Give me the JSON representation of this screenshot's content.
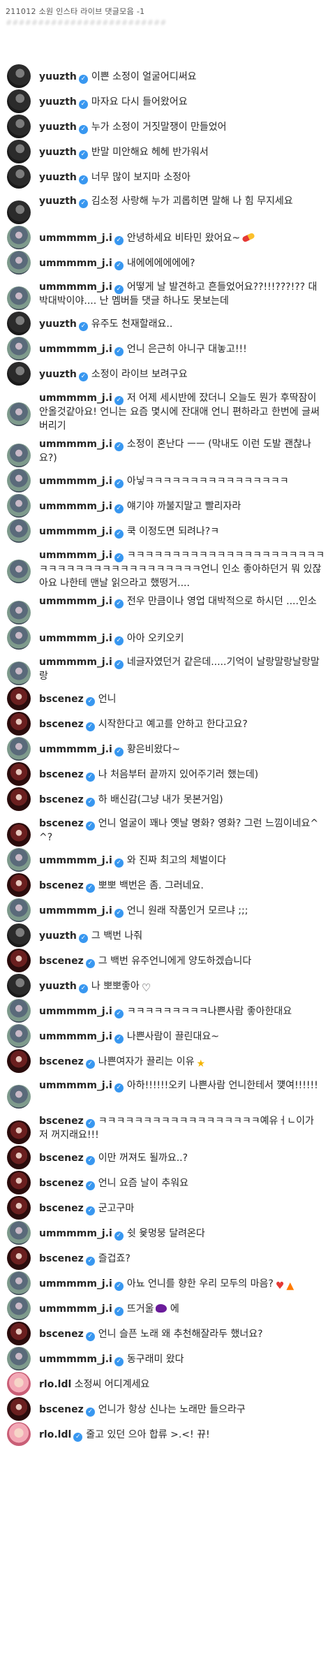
{
  "header": {
    "title": "211012 소원 인스타 라이브 댓글모음 -1",
    "subtitle": "#########################"
  },
  "users": {
    "yuuzth": "yuuzth",
    "ummmmm": "ummmmm_j.i",
    "bscenez": "bscenez",
    "rlo": "rlo.ldl"
  },
  "verified_icon": "verified-check-icon",
  "comments": [
    {
      "user": "yuuzth",
      "avatar": "yuuzth",
      "text": "이쁜 소정이 얼굴어디써요",
      "lines": 1
    },
    {
      "user": "yuuzth",
      "avatar": "yuuzth",
      "text": "마자요 다시 들어왔어요",
      "lines": 1
    },
    {
      "user": "yuuzth",
      "avatar": "yuuzth",
      "text": "누가 소정이 거짓말쟁이 만들었어",
      "lines": 1
    },
    {
      "user": "yuuzth",
      "avatar": "yuuzth",
      "text": "반말 미안해요 헤헤 반가워서",
      "lines": 1
    },
    {
      "user": "yuuzth",
      "avatar": "yuuzth",
      "text": "너무 많이 보지마 소정아",
      "lines": 1
    },
    {
      "user": "yuuzth",
      "avatar": "yuuzth",
      "text": "김소정 사랑해 누가 괴롭히면 말해 나 힘 무지세요",
      "lines": 2
    },
    {
      "user": "ummmmm",
      "avatar": "ummmmm",
      "text": "안녕하세요 비타민 왔어요~",
      "emoji": "pill",
      "lines": 1
    },
    {
      "user": "ummmmm",
      "avatar": "ummmmm",
      "text": "내에에에에에에?",
      "lines": 1
    },
    {
      "user": "ummmmm",
      "avatar": "ummmmm",
      "text": "어떻게 날 발견하고 흔들었어요??!!!???!?? 대박대박이야.... 난 멤버들 댓글 하나도 못보는데",
      "lines": 2
    },
    {
      "user": "yuuzth",
      "avatar": "yuuzth",
      "text": "유주도 천재할래요..",
      "lines": 1
    },
    {
      "user": "ummmmm",
      "avatar": "ummmmm",
      "text": "언니 은근히 아니구 대놓고!!!",
      "lines": 1
    },
    {
      "user": "yuuzth",
      "avatar": "yuuzth",
      "text": "소정이 라이브 보려구요",
      "lines": 1
    },
    {
      "user": "ummmmm",
      "avatar": "ummmmm",
      "text": "저 어제 세시반에 잤더니 오늘도 뭔가 후딱잠이 안올것같아요! 언니는 요즘 몇시에 잔대애 언니 편하라고 한번에 글써버리기",
      "lines": 3
    },
    {
      "user": "ummmmm",
      "avatar": "ummmmm",
      "text": "소정이 혼난다 ㅡㅡ (막내도 이런 도발 괜찮나요?)",
      "lines": 2
    },
    {
      "user": "ummmmm",
      "avatar": "ummmmm",
      "text": "아닣ㅋㅋㅋㅋㅋㅋㅋㅋㅋㅋㅋㅋㅋㅋㅋㅋ",
      "lines": 1
    },
    {
      "user": "ummmmm",
      "avatar": "ummmmm",
      "text": "얘기야 까불지말고 빨리자라",
      "lines": 1
    },
    {
      "user": "ummmmm",
      "avatar": "ummmmm",
      "text": "쿡 이정도면 되려나?ㅋ",
      "lines": 1
    },
    {
      "user": "ummmmm",
      "avatar": "ummmmm",
      "text": "ㅋㅋㅋㅋㅋㅋㅋㅋㅋㅋㅋㅋㅋㅋㅋㅋㅋㅋㅋㅋㅋㅋㅋㅋㅋㅋㅋㅋㅋㅋㅋㅋㅋㅋㅋㅋㅋㅋㅋㅋ언니 인소 좋아하던거 뭐 있잖아요 나한테 맨날 읽으라고 했떵거....",
      "lines": 3
    },
    {
      "user": "ummmmm",
      "avatar": "ummmmm",
      "text": "전우 만큼이나 영업 대박적으로 하시던 ....인소",
      "lines": 2
    },
    {
      "user": "ummmmm",
      "avatar": "ummmmm",
      "text": "아아 오키오키",
      "lines": 1
    },
    {
      "user": "ummmmm",
      "avatar": "ummmmm",
      "text": "네글자였던거 같은데.....기억이 날랑말랑날랑말랑",
      "lines": 2
    },
    {
      "user": "bscenez",
      "avatar": "bscenez",
      "text": "언니",
      "lines": 1
    },
    {
      "user": "bscenez",
      "avatar": "bscenez",
      "text": "시작한다고 예고를 안하고 한다고요?",
      "lines": 1
    },
    {
      "user": "ummmmm",
      "avatar": "ummmmm",
      "text": "황은비왔다~",
      "lines": 1
    },
    {
      "user": "bscenez",
      "avatar": "bscenez",
      "text": "나 처음부터 끝까지 있어주기러 했는데)",
      "lines": 1
    },
    {
      "user": "bscenez",
      "avatar": "bscenez",
      "text": "하 배신감(그냥 내가 못본거임)",
      "lines": 1
    },
    {
      "user": "bscenez",
      "avatar": "bscenez",
      "text": "언니 얼굴이 꽤나 옛날 명화? 영화? 그런 느낌이네요^^?",
      "lines": 2
    },
    {
      "user": "ummmmm",
      "avatar": "ummmmm",
      "text": "와 진짜 최고의 체벌이다",
      "lines": 1
    },
    {
      "user": "bscenez",
      "avatar": "bscenez",
      "text": "뽀뽀 백번은 좀. 그러네요.",
      "lines": 1
    },
    {
      "user": "ummmmm",
      "avatar": "ummmmm",
      "text": "언니 원래 작품인거 모르냐 ;;;",
      "lines": 1
    },
    {
      "user": "yuuzth",
      "avatar": "yuuzth",
      "text": "그 백번 나줘",
      "lines": 1
    },
    {
      "user": "bscenez",
      "avatar": "bscenez",
      "text": "그 백번 유주언니에게 양도하겠습니다",
      "lines": 1
    },
    {
      "user": "yuuzth",
      "avatar": "yuuzth",
      "text": "나 뽀뽀좋아",
      "emoji": "heart-outline",
      "lines": 1
    },
    {
      "user": "ummmmm",
      "avatar": "ummmmm",
      "text": "ㅋㅋㅋㅋㅋㅋㅋㅋㅋ나쁜사람 좋아한대요",
      "lines": 1
    },
    {
      "user": "ummmmm",
      "avatar": "ummmmm",
      "text": "나쁜사람이 끌린대요~",
      "lines": 1
    },
    {
      "user": "bscenez",
      "avatar": "bscenez",
      "text": "나쁜여자가 끌리는 이유",
      "emoji": "star",
      "lines": 1
    },
    {
      "user": "ummmmm",
      "avatar": "ummmmm",
      "text": "아하!!!!!!오키 나쁜사람 언니한테서 꺶여!!!!!!",
      "lines": 2
    },
    {
      "user": "bscenez",
      "avatar": "bscenez",
      "text": "ㅋㅋㅋㅋㅋㅋㅋㅋㅋㅋㅋㅋㅋㅋㅋㅋㅋㅋ예유ㅓㄴ이가 저 꺼지래요!!!",
      "lines": 2
    },
    {
      "user": "bscenez",
      "avatar": "bscenez",
      "text": "이만 꺼져도 될까요..?",
      "lines": 1
    },
    {
      "user": "bscenez",
      "avatar": "bscenez",
      "text": "언니 요즘 날이 추워요",
      "lines": 1
    },
    {
      "user": "bscenez",
      "avatar": "bscenez",
      "text": "군고구마",
      "lines": 1
    },
    {
      "user": "ummmmm",
      "avatar": "ummmmm",
      "text": "쉿 윷멍뭉 달려온다",
      "lines": 1
    },
    {
      "user": "bscenez",
      "avatar": "bscenez",
      "text": "즐겁죠?",
      "lines": 1
    },
    {
      "user": "ummmmm",
      "avatar": "ummmmm",
      "text": "아뇨 언니를 향한 우리 모두의 마음?",
      "emoji": "heart-fire",
      "lines": 1
    },
    {
      "user": "ummmmm",
      "avatar": "ummmmm",
      "text": "뜨거울",
      "emoji": "eggplant",
      "suffix": "에",
      "lines": 1
    },
    {
      "user": "bscenez",
      "avatar": "bscenez",
      "text": "언니 슬픈 노래 왜 추천해잘라두 했너요?",
      "lines": 1
    },
    {
      "user": "ummmmm",
      "avatar": "ummmmm",
      "text": "동구래미 왔다",
      "lines": 1
    },
    {
      "user": "rlo",
      "avatar": "rlo",
      "text": "소정씨 어디계세요",
      "lines": 1,
      "no_badge": true
    },
    {
      "user": "bscenez",
      "avatar": "bscenez",
      "text": "언니가 항상 신나는 노래만 들으라구",
      "lines": 1
    },
    {
      "user": "rlo",
      "avatar": "rlo",
      "text": "줄고 있던 으아 합류 >.<! 뀨!",
      "lines": 1
    }
  ]
}
